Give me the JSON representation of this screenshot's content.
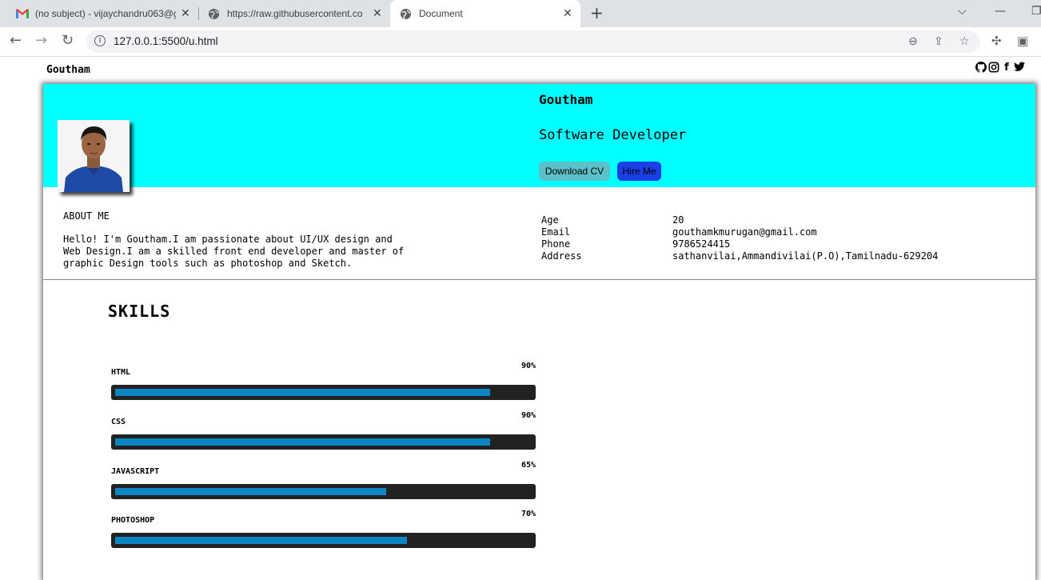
{
  "browser": {
    "tabs": [
      {
        "title": "(no subject) - vijaychandru063@g",
        "icon": "gmail-icon",
        "active": false
      },
      {
        "title": "https://raw.githubusercontent.co",
        "icon": "globe-icon",
        "active": false
      },
      {
        "title": "Document",
        "icon": "globe-icon",
        "active": true
      }
    ],
    "address": "127.0.0.1:5500/u.html"
  },
  "page": {
    "brand": "Goutham",
    "social_icons": [
      "github-icon",
      "instagram-icon",
      "facebook-icon",
      "twitter-icon"
    ],
    "hero": {
      "name": "Goutham",
      "role": "Software Developer",
      "download_cv": "Download CV",
      "hire_me": "Hire Me",
      "accent_color": "#00ffff"
    },
    "about": {
      "title": "ABOUT ME",
      "text": "Hello! I'm Goutham.I am passionate about UI/UX design and\nWeb Design.I am a skilled front end developer and master of\ngraphic Design tools such as photoshop and Sketch."
    },
    "info": [
      {
        "label": "Age",
        "value": "20"
      },
      {
        "label": "Email",
        "value": "gouthamkmurugan@gmail.com"
      },
      {
        "label": "Phone",
        "value": "9786524415"
      },
      {
        "label": "Address",
        "value": "sathanvilai,Ammandivilai(P.O),Tamilnadu-629204"
      }
    ],
    "skills_title": "SKILLS",
    "skills": [
      {
        "name": "HTML",
        "percent_label": "90%",
        "level": 0.9
      },
      {
        "name": "CSS",
        "percent_label": "90%",
        "level": 0.9
      },
      {
        "name": "JAVASCRIPT",
        "percent_label": "65%",
        "level": 0.65
      },
      {
        "name": "PHOTOSHOP",
        "percent_label": "70%",
        "level": 0.7
      }
    ]
  }
}
